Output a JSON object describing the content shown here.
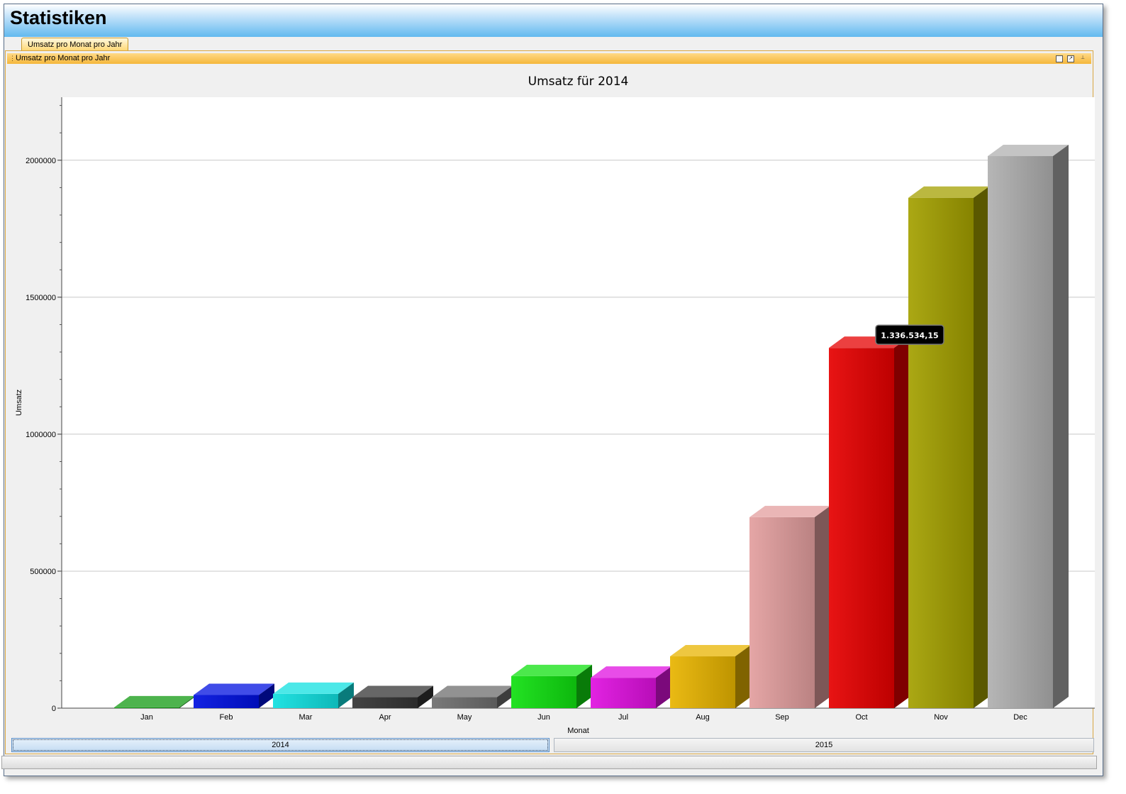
{
  "app": {
    "title": "Statistiken"
  },
  "tab": {
    "label": "Umsatz pro Monat pro Jahr"
  },
  "panel": {
    "title": "Umsatz pro Monat pro Jahr",
    "grip": "⋮",
    "icons": [
      "maximize-icon",
      "restore-icon",
      "pin-icon"
    ]
  },
  "chart_data": {
    "type": "bar",
    "title": "Umsatz für 2014",
    "xlabel": "Monat",
    "ylabel": "Umsatz",
    "categories": [
      "Jan",
      "Feb",
      "Mar",
      "Apr",
      "May",
      "Jun",
      "Jul",
      "Aug",
      "Sep",
      "Oct",
      "Nov",
      "Dec"
    ],
    "values": [
      3000,
      48000,
      52000,
      40000,
      40000,
      117000,
      111000,
      189000,
      697000,
      1315000,
      1863000,
      2015000
    ],
    "colors": [
      "#119911",
      "#0010e0",
      "#10e0e0",
      "#343434",
      "#6e6e6e",
      "#10e010",
      "#e010e0",
      "#e8b400",
      "#e39e9e",
      "#e60000",
      "#a4a000",
      "#b0b0b0"
    ],
    "ylim": [
      0,
      2230000
    ],
    "yticks": [
      0,
      500000,
      1000000,
      1500000,
      2000000
    ],
    "ytick_labels": [
      "0",
      "500000",
      "1000000",
      "1500000",
      "2000000"
    ],
    "grid": true,
    "legend": "none",
    "tooltip": {
      "category": "Oct",
      "text": "1.336.534,15"
    }
  },
  "year_buttons": [
    {
      "label": "2014",
      "selected": true
    },
    {
      "label": "2015",
      "selected": false
    }
  ]
}
